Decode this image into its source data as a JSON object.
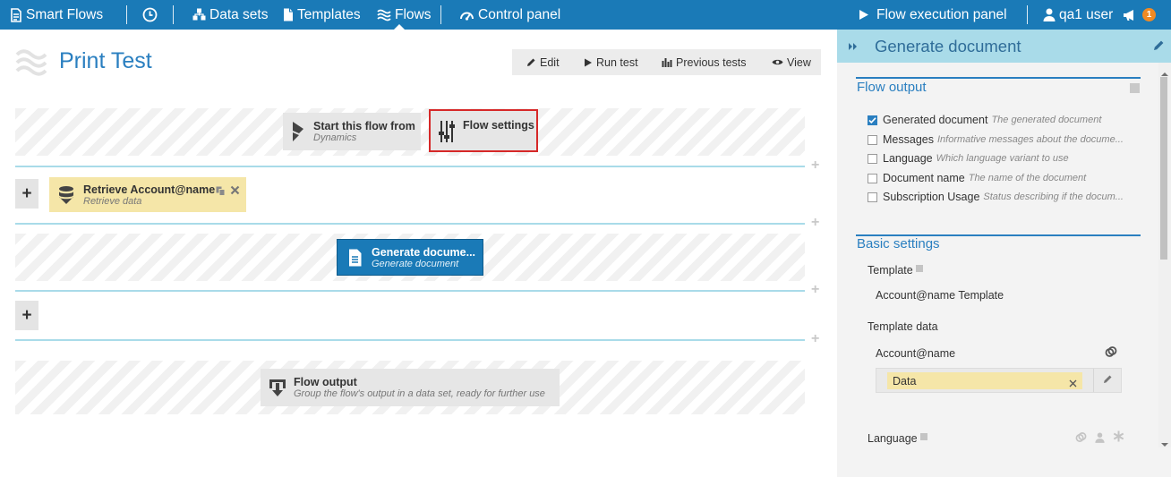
{
  "nav": {
    "brand": "Smart Flows",
    "datasets": "Data sets",
    "templates": "Templates",
    "flows": "Flows",
    "control_panel": "Control panel",
    "flow_execution_panel": "Flow execution panel",
    "user": "qa1 user",
    "notification_count": "1"
  },
  "page": {
    "title": "Print Test"
  },
  "toolbar": {
    "edit": "Edit",
    "run_test": "Run test",
    "previous_tests": "Previous tests",
    "view": "View"
  },
  "canvas": {
    "start_node": {
      "title": "Start this flow from",
      "subtitle": "Dynamics"
    },
    "flow_settings": {
      "title": "Flow settings"
    },
    "retrieve_node": {
      "title": "Retrieve Account@name",
      "subtitle": "Retrieve data"
    },
    "generate_node": {
      "title": "Generate docume...",
      "subtitle": "Generate document"
    },
    "output_node": {
      "title": "Flow output",
      "subtitle": "Group the flow's output in a data set, ready for further use"
    },
    "plus_label": "+"
  },
  "panel": {
    "title": "Generate document",
    "flow_output_heading": "Flow output",
    "outputs": [
      {
        "label": "Generated document",
        "desc": "The generated document",
        "checked": true
      },
      {
        "label": "Messages",
        "desc": "Informative messages about the docume...",
        "checked": false
      },
      {
        "label": "Language",
        "desc": "Which language variant to use",
        "checked": false
      },
      {
        "label": "Document name",
        "desc": "The name of the document",
        "checked": false
      },
      {
        "label": "Subscription Usage",
        "desc": "Status describing if the docum...",
        "checked": false
      }
    ],
    "basic_settings_heading": "Basic settings",
    "template_label": "Template",
    "template_value": "Account@name Template",
    "template_data_label": "Template data",
    "account_label": "Account@name",
    "data_chip": "Data",
    "language_label": "Language"
  },
  "colors": {
    "nav_bg": "#1a7ab7",
    "accent": "#2a7fc0",
    "panel_header": "#a9dbe9",
    "generate_node": "#1a7ab7",
    "retrieve_node": "#f5e6a8",
    "selected_outline": "#d62828",
    "notification": "#f08a24"
  }
}
